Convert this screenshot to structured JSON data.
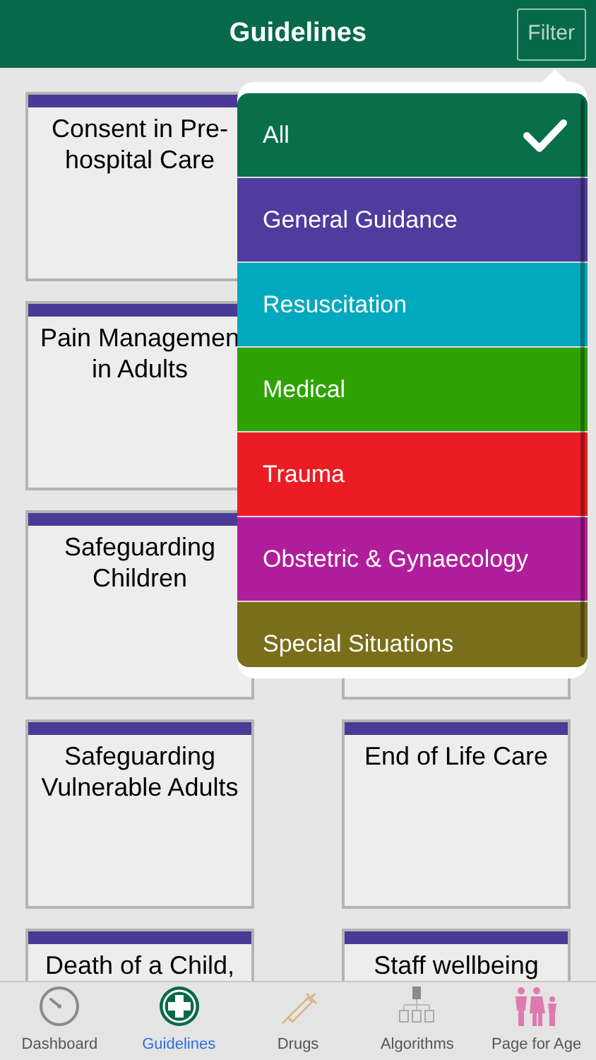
{
  "header": {
    "title": "Guidelines",
    "filter_button": "Filter"
  },
  "card_rows": [
    {
      "left": {
        "title": "Consent in Pre-hospital Care",
        "color": "#4a3a96"
      }
    },
    {
      "left": {
        "title": "Pain Managemen in Adults",
        "color": "#4a3a96"
      }
    },
    {
      "left": {
        "title": "Safeguarding Children",
        "color": "#4a3a96"
      }
    },
    {
      "left": {
        "title": "Safeguarding Vulnerable Adults",
        "color": "#4a3a96"
      },
      "right": {
        "title": "End of Life Care",
        "color": "#4a3a96"
      }
    },
    {
      "left": {
        "title": "Death of a Child,",
        "color": "#4a3a96"
      },
      "right": {
        "title": "Staff wellbeing",
        "color": "#4a3a96"
      }
    }
  ],
  "filter_menu": [
    {
      "label": "All",
      "color": "#086f4a",
      "selected": true
    },
    {
      "label": "General Guidance",
      "color": "#4e3c9e",
      "selected": false
    },
    {
      "label": "Resuscitation",
      "color": "#00a9bd",
      "selected": false
    },
    {
      "label": "Medical",
      "color": "#2fa203",
      "selected": false
    },
    {
      "label": "Trauma",
      "color": "#ec1c24",
      "selected": false
    },
    {
      "label": "Obstetric & Gynaecology",
      "color": "#b11e9b",
      "selected": false
    },
    {
      "label": "Special Situations",
      "color": "#7a6e1b",
      "selected": false
    }
  ],
  "tabs": [
    {
      "kind": "dashboard",
      "label": "Dashboard",
      "selected": false
    },
    {
      "kind": "guidelines",
      "label": "Guidelines",
      "selected": true
    },
    {
      "kind": "drugs",
      "label": "Drugs",
      "selected": false
    },
    {
      "kind": "algorithms",
      "label": "Algorithms",
      "selected": false
    },
    {
      "kind": "age",
      "label": "Page for Age",
      "selected": false
    }
  ]
}
